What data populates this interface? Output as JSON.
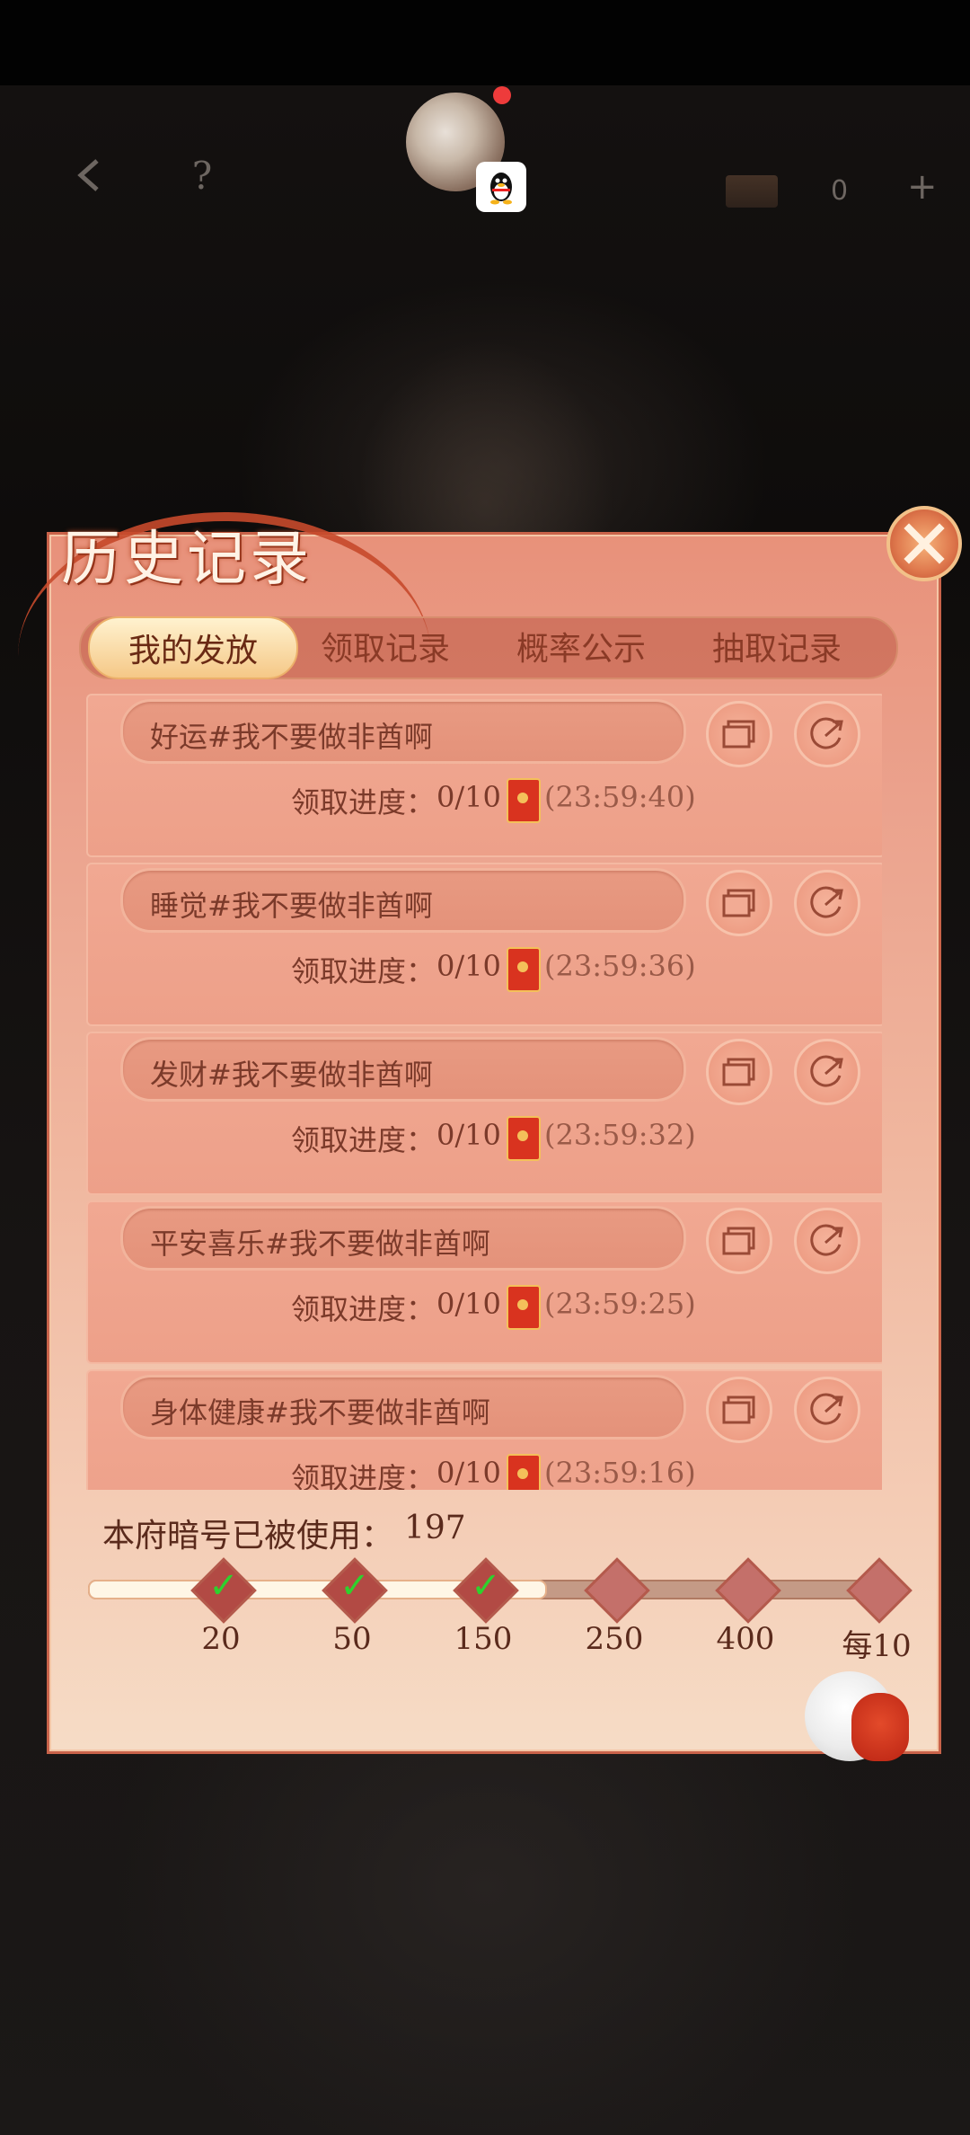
{
  "top_bar": {
    "back_icon": "back-arrow-icon",
    "help_label": "?",
    "currency_value": "0",
    "plus_label": "+"
  },
  "panel": {
    "title": "历史记录",
    "tabs": [
      {
        "label": "我的发放",
        "active": true
      },
      {
        "label": "领取记录",
        "active": false
      },
      {
        "label": "概率公示",
        "active": false
      },
      {
        "label": "抽取记录",
        "active": false
      }
    ]
  },
  "records": [
    {
      "name": "好运#我不要做非酋啊",
      "progress_label": "领取进度：",
      "progress": "0/10",
      "timer": "(23:59:40)"
    },
    {
      "name": "睡觉#我不要做非酋啊",
      "progress_label": "领取进度：",
      "progress": "0/10",
      "timer": "(23:59:36)"
    },
    {
      "name": "发财#我不要做非酋啊",
      "progress_label": "领取进度：",
      "progress": "0/10",
      "timer": "(23:59:32)"
    },
    {
      "name": "平安喜乐#我不要做非酋啊",
      "progress_label": "领取进度：",
      "progress": "0/10",
      "timer": "(23:59:25)"
    },
    {
      "name": "身体健康#我不要做非酋啊",
      "progress_label": "领取进度：",
      "progress": "0/10",
      "timer": "(23:59:16)"
    }
  ],
  "usage": {
    "label": "本府暗号已被使用：",
    "value": "197",
    "progress_fraction": 0.56,
    "milestones": [
      {
        "label": "20",
        "reached": true
      },
      {
        "label": "50",
        "reached": true
      },
      {
        "label": "150",
        "reached": true
      },
      {
        "label": "250",
        "reached": false
      },
      {
        "label": "400",
        "reached": false
      },
      {
        "label": "每10",
        "reached": false
      }
    ]
  },
  "colors": {
    "panel_top": "#e8917a",
    "panel_bottom": "#f6dcc6",
    "accent_red": "#c9634a",
    "check_green": "#2ed12e",
    "text_brown": "#7b3a2a"
  }
}
